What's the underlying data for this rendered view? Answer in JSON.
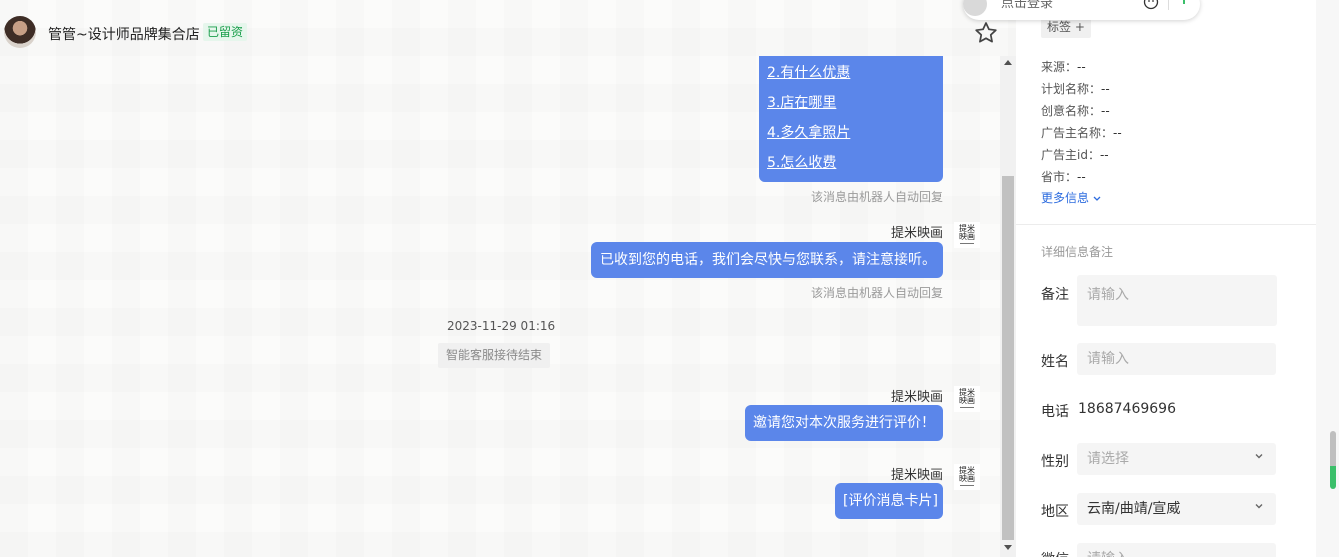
{
  "header": {
    "shop_name": "管管~设计师品牌集合店",
    "consult_badge": "已留资"
  },
  "messages": {
    "menu_links": [
      "2.有什么优惠",
      "3.店在哪里",
      "4.多久拿照片",
      "5.怎么收费"
    ],
    "robot_note": "该消息由机器人自动回复",
    "sender_name": "提米映画",
    "agent_avatar_text": [
      "提米",
      "映画"
    ],
    "phone_reply": "已收到您的电话，我们会尽快与您联系，请注意接听。",
    "timestamp": "2023-11-29 01:16",
    "session_end": "智能客服接待结束",
    "rate_invite": "邀请您对本次服务进行评价！",
    "rate_card": "[评价消息卡片]"
  },
  "login_widget": {
    "text": "点击登录"
  },
  "info": {
    "tag_label": "标签 +",
    "meta": [
      {
        "label": "来源：",
        "value": "--"
      },
      {
        "label": "计划名称：",
        "value": "--"
      },
      {
        "label": "创意名称：",
        "value": "--"
      },
      {
        "label": "广告主名称：",
        "value": "--"
      },
      {
        "label": "广告主id：",
        "value": "--"
      },
      {
        "label": "省市：",
        "value": "--"
      }
    ],
    "more_info": "更多信息",
    "detail_title": "详细信息备注",
    "fields": {
      "remark_label": "备注",
      "remark_placeholder": "请输入",
      "name_label": "姓名",
      "name_placeholder": "请输入",
      "phone_label": "电话",
      "phone_value": "18687469696",
      "gender_label": "性别",
      "gender_placeholder": "请选择",
      "region_label": "地区",
      "region_value": "云南/曲靖/宣威",
      "wechat_label": "微信",
      "wechat_placeholder": "请输入"
    }
  },
  "colors": {
    "bubble": "#5b86ea",
    "badge_text": "#1a9e4b",
    "link": "#2d6cdf"
  }
}
